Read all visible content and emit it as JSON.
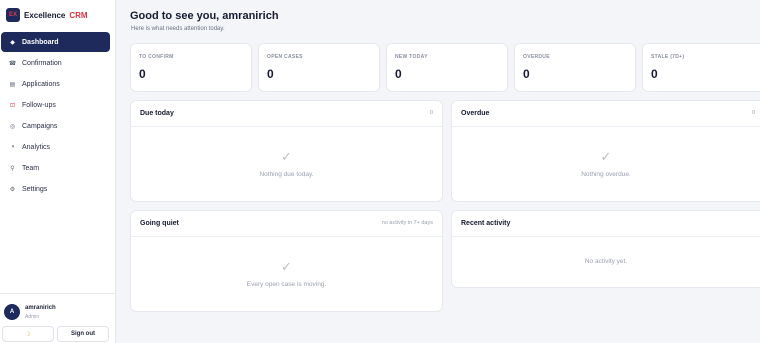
{
  "brand": {
    "logo_text": "EX",
    "name": "Excellence",
    "accent": "CRM"
  },
  "nav": [
    {
      "label": "Dashboard",
      "icon": "diamond-icon",
      "glyph": "◆"
    },
    {
      "label": "Confirmation",
      "icon": "inbox-icon",
      "glyph": "☎"
    },
    {
      "label": "Applications",
      "icon": "list-icon",
      "glyph": "▤"
    },
    {
      "label": "Follow-ups",
      "icon": "bell-icon",
      "glyph": "⊡"
    },
    {
      "label": "Campaigns",
      "icon": "target-icon",
      "glyph": "◎"
    },
    {
      "label": "Analytics",
      "icon": "chart-icon",
      "glyph": "◑"
    },
    {
      "label": "Team",
      "icon": "person-icon",
      "glyph": "⚲"
    },
    {
      "label": "Settings",
      "icon": "gear-icon",
      "glyph": "⚙"
    }
  ],
  "user": {
    "initial": "A",
    "name": "amranirich",
    "role": "Admin"
  },
  "footer": {
    "theme_glyph": "☽",
    "signout_label": "Sign out"
  },
  "header": {
    "greeting": "Good to see you, amranirich",
    "subtitle": "Here is what needs attention today."
  },
  "stats": [
    {
      "label": "TO CONFIRM",
      "value": "0"
    },
    {
      "label": "OPEN CASES",
      "value": "0"
    },
    {
      "label": "NEW TODAY",
      "value": "0"
    },
    {
      "label": "OVERDUE",
      "value": "0"
    },
    {
      "label": "STALE (7D+)",
      "value": "0"
    }
  ],
  "cards": {
    "due_today": {
      "title": "Due today",
      "meta": "0",
      "empty": "Nothing due today.",
      "check": "✓"
    },
    "overdue": {
      "title": "Overdue",
      "meta": "0",
      "empty": "Nothing overdue.",
      "check": "✓"
    },
    "going_quiet": {
      "title": "Going quiet",
      "meta": "no activity in 7+ days",
      "empty": "Every open case is moving.",
      "check": "✓"
    },
    "recent_activity": {
      "title": "Recent activity",
      "empty": "No activity yet."
    }
  }
}
